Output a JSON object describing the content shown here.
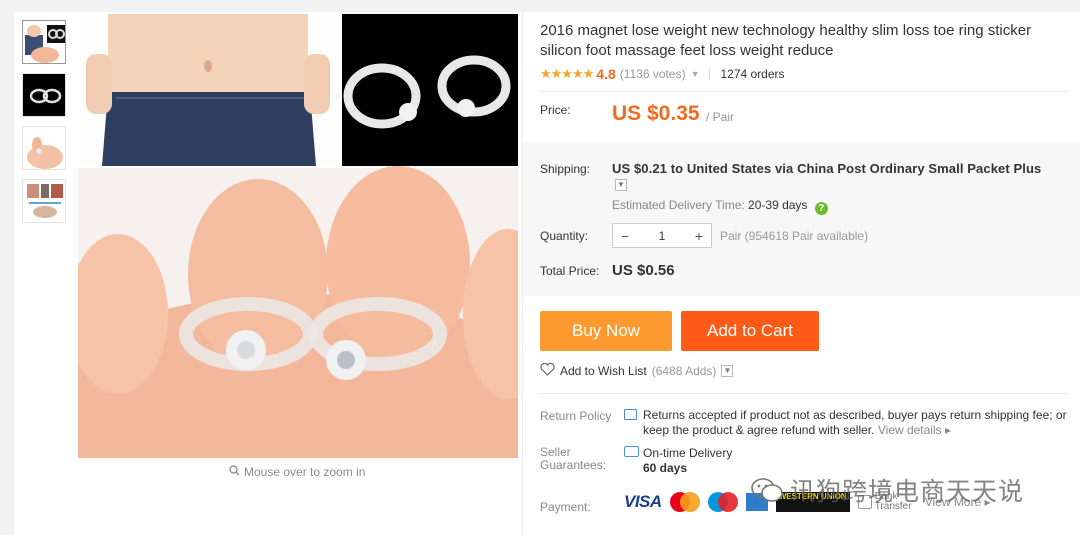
{
  "product": {
    "title": "2016 magnet lose weight new technology healthy slim loss toe ring sticker silicon foot massage feet loss weight reduce",
    "stars": "★★★★★",
    "rating": "4.8",
    "votes": "(1136 votes)",
    "orders": "1274 orders"
  },
  "price": {
    "label": "Price:",
    "value": "US $0.35",
    "unit": "/ Pair"
  },
  "shipping": {
    "label": "Shipping:",
    "text": "US $0.21 to United States via China Post Ordinary Small Packet Plus",
    "delivery_label": "Estimated Delivery Time:",
    "delivery_value": "20-39 days"
  },
  "quantity": {
    "label": "Quantity:",
    "minus": "−",
    "value": "1",
    "plus": "+",
    "info": "Pair (954618 Pair available)"
  },
  "total": {
    "label": "Total Price:",
    "value": "US $0.56"
  },
  "actions": {
    "buy_now": "Buy Now",
    "add_to_cart": "Add to Cart",
    "wish_list": "Add to Wish List",
    "wish_adds": "(6488 Adds)"
  },
  "return_policy": {
    "label": "Return Policy",
    "text": "Returns accepted if product not as described, buyer pays return shipping fee; or keep the product & agree refund with seller.",
    "link": "View details ▸"
  },
  "seller_guarantees": {
    "label": "Seller Guarantees:",
    "line1": "On-time Delivery",
    "line2": "60 days"
  },
  "payment": {
    "label": "Payment:",
    "visa": "VISA",
    "western_union": "WESTERN UNION",
    "bank": "Bank Transfer",
    "view_more": "View More ▸"
  },
  "gallery": {
    "zoom_hint": "Mouse over to zoom in"
  },
  "watermark": "讯狗跨境电商天天说",
  "colors": {
    "accent_orange": "#f26b1d",
    "buy_now": "#fc9a2f",
    "add_to_cart": "#ff5a16"
  }
}
